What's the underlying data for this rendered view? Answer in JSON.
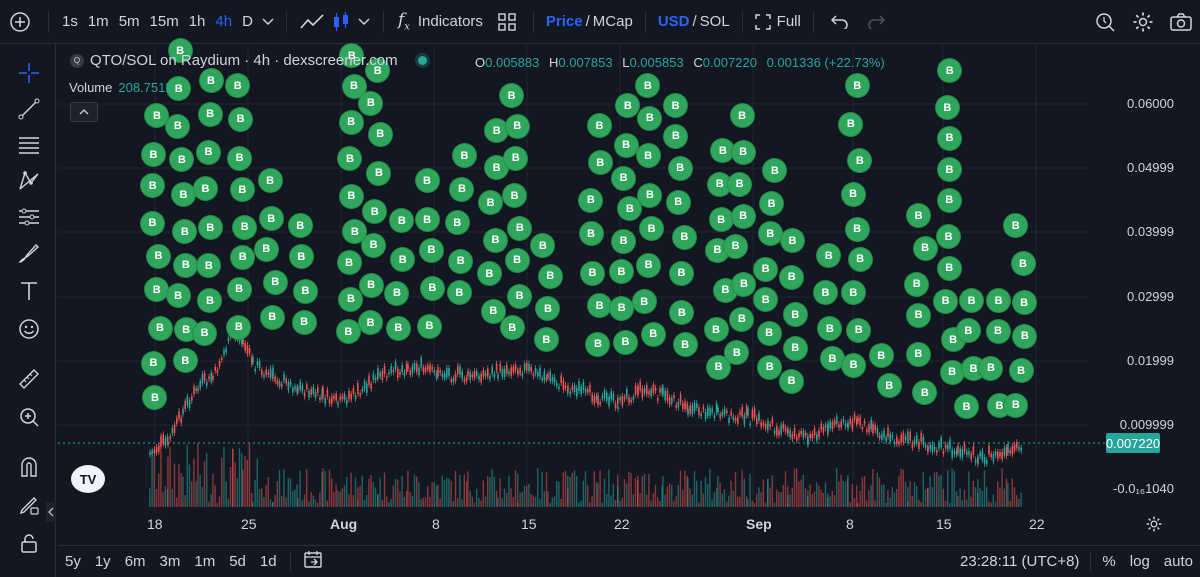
{
  "toolbar": {
    "timeframes": [
      "1s",
      "1m",
      "5m",
      "15m",
      "1h",
      "4h",
      "D"
    ],
    "active_timeframe": "4h",
    "indicators_label": "Indicators",
    "price_label": "Price",
    "mcap_label": "MCap",
    "usd_label": "USD",
    "sol_label": "SOL",
    "full_label": "Full"
  },
  "legend": {
    "symbol": "QTO/SOL on Raydium · 4h · dexscreener.com",
    "open_prefix": "O",
    "open": "0.005883",
    "high_prefix": "H",
    "high": "0.007853",
    "low_prefix": "L",
    "low": "0.005853",
    "close_prefix": "C",
    "close": "0.007220",
    "change": "0.001336 (+22.73%)",
    "volume_label": "Volume",
    "volume_value": "208.751K"
  },
  "yaxis": {
    "labels": [
      "0.06000",
      "0.04999",
      "0.03999",
      "0.02999",
      "0.01999",
      "0.009999",
      "-0.0₁₆1040"
    ],
    "current_price": "0.007220"
  },
  "xaxis": {
    "labels": [
      "18",
      "25",
      "Aug",
      "8",
      "15",
      "22",
      "Sep",
      "8",
      "15",
      "22"
    ]
  },
  "bottom": {
    "ranges": [
      "5y",
      "1y",
      "6m",
      "3m",
      "1m",
      "5d",
      "1d"
    ],
    "time": "23:28:11 (UTC+8)",
    "pct_label": "%",
    "log_label": "log",
    "auto_label": "auto"
  },
  "marker_label": "B",
  "colors": {
    "bg": "#131722",
    "accent": "#2962ff",
    "up": "#26a69a",
    "down": "#ef5350",
    "marker": "#2fa65b"
  }
}
